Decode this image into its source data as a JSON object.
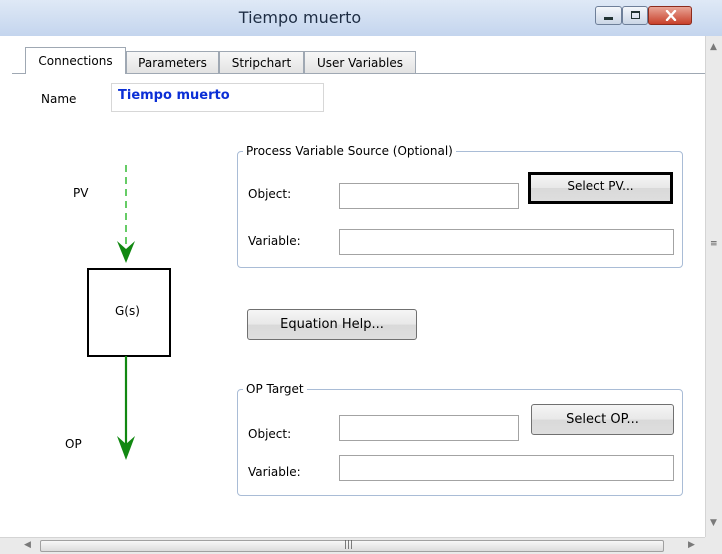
{
  "window": {
    "title": "Tiempo muerto",
    "colors": {
      "title_bar": "#c4d5ee",
      "close_button": "#c8402a",
      "name_text": "#0b2fd6",
      "pv_arrow": "#66cc66",
      "op_arrow": "#118811"
    }
  },
  "tabs": [
    {
      "label": "Connections",
      "active": true
    },
    {
      "label": "Parameters",
      "active": false
    },
    {
      "label": "Stripchart",
      "active": false
    },
    {
      "label": "User Variables",
      "active": false
    }
  ],
  "name_field": {
    "label": "Name",
    "value": "Tiempo muerto"
  },
  "diagram": {
    "pv_label": "PV",
    "block_label": "G(s)",
    "op_label": "OP"
  },
  "pv_source": {
    "title": "Process Variable Source (Optional)",
    "object_label": "Object:",
    "object_value": "",
    "variable_label": "Variable:",
    "variable_value": "",
    "select_button": "Select PV..."
  },
  "equation_help_button": "Equation Help...",
  "op_target": {
    "title": "OP Target",
    "object_label": "Object:",
    "object_value": "",
    "variable_label": "Variable:",
    "variable_value": "",
    "select_button": "Select OP..."
  },
  "icons": {
    "minimize": "minimize-icon",
    "maximize": "maximize-icon",
    "close": "close-icon",
    "scroll_up": "scroll-up-arrow-icon",
    "scroll_down": "scroll-down-arrow-icon",
    "scroll_left": "scroll-left-arrow-icon",
    "scroll_right": "scroll-right-arrow-icon"
  }
}
